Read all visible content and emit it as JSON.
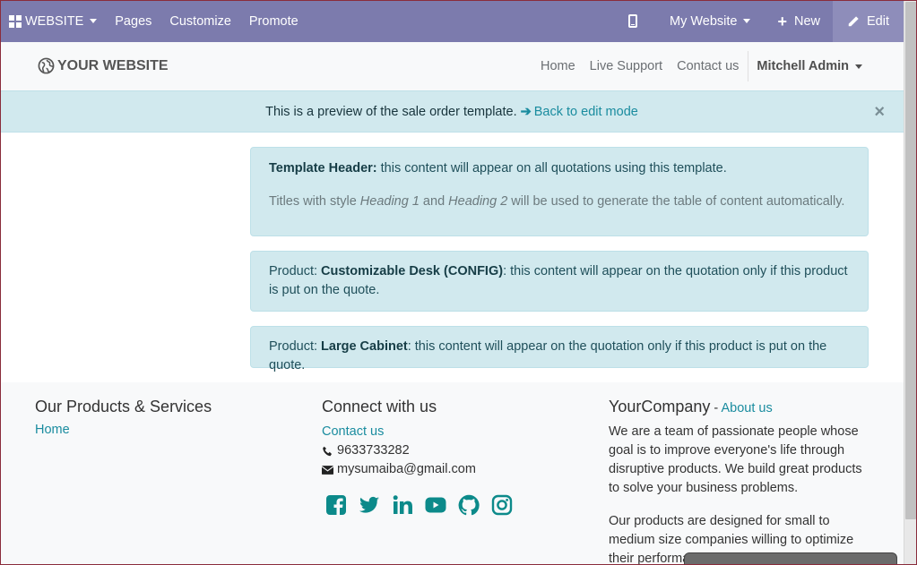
{
  "topbar": {
    "website_label": "WEBSITE",
    "pages_label": "Pages",
    "customize_label": "Customize",
    "promote_label": "Promote",
    "my_website_label": "My Website",
    "new_label": "New",
    "edit_label": "Edit",
    "bg_color": "#7c7bad"
  },
  "header": {
    "logo_text": "YOUR WEBSITE",
    "nav": [
      "Home",
      "Live Support",
      "Contact us"
    ],
    "user": "Mitchell Admin"
  },
  "alert": {
    "message": "This is a preview of the sale order template.",
    "link": "Back to edit mode",
    "close": "×"
  },
  "cards": {
    "header_bold": "Template Header:",
    "header_text": " this content will appear on all quotations using this template.",
    "titles_pre": "Titles with style ",
    "titles_h1": "Heading 1",
    "titles_mid": " and ",
    "titles_h2": "Heading 2",
    "titles_post": " will be used to generate the table of content automatically.",
    "p1_pre": "Product: ",
    "p1_name": "Customizable Desk (CONFIG)",
    "p1_post": ": this content will appear on the quotation only if this product is put on the quote.",
    "p2_pre": "Product: ",
    "p2_name": "Large Cabinet",
    "p2_post": ": this content will appear on the quotation only if this product is put on the quote."
  },
  "footer": {
    "col1_title": "Our Products & Services",
    "col1_link": "Home",
    "col2_title": "Connect with us",
    "col2_link": "Contact us",
    "phone": "9633733282",
    "email": "mysumaiba@gmail.com",
    "col3_title": "YourCompany",
    "col3_sep": " - ",
    "col3_link": "About us",
    "about_p1": "We are a team of passionate people whose goal is to improve everyone's life through disruptive products. We build great products to solve your business problems.",
    "about_p2": "Our products are designed for small to medium size companies willing to optimize their performance.",
    "social_icons": [
      "facebook-icon",
      "twitter-icon",
      "linkedin-icon",
      "youtube-icon",
      "github-icon",
      "instagram-icon"
    ],
    "accent_color": "#1a8c9f"
  }
}
